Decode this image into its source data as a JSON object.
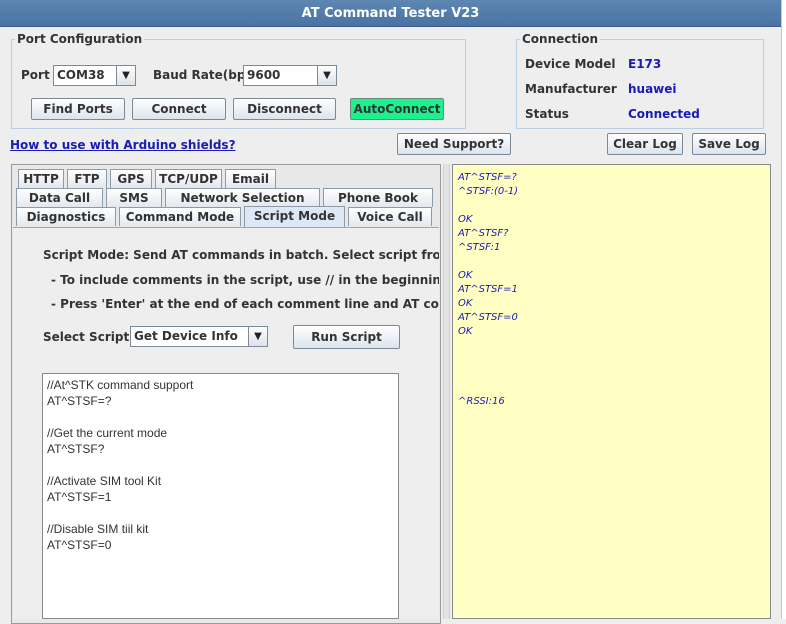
{
  "window": {
    "title": "AT Command Tester V23"
  },
  "port_config": {
    "legend": "Port Configuration",
    "port_label": "Port",
    "port_value": "COM38",
    "baud_label": "Baud Rate(bps)",
    "baud_value": "9600",
    "buttons": {
      "find_ports": "Find Ports",
      "connect": "Connect",
      "disconnect": "Disconnect",
      "autoconnect": "AutoConnect"
    }
  },
  "connection": {
    "legend": "Connection",
    "device_model_label": "Device Model",
    "device_model_value": "E173",
    "manufacturer_label": "Manufacturer",
    "manufacturer_value": "huawei",
    "status_label": "Status",
    "status_value": "Connected"
  },
  "toolbar": {
    "arduino_link": "How to use with Arduino shields?",
    "need_support": "Need Support?",
    "clear_log": "Clear Log",
    "save_log": "Save Log"
  },
  "tabs": {
    "row1": [
      "HTTP",
      "FTP",
      "GPS",
      "TCP/UDP",
      "Email"
    ],
    "row2": [
      "Data Call",
      "SMS",
      "Network Selection",
      "Phone Book"
    ],
    "row3": [
      "Diagnostics",
      "Command Mode",
      "Script Mode",
      "Voice Call"
    ],
    "active": "Script Mode"
  },
  "script_mode": {
    "description": "Script Mode: Send AT commands in batch. Select script from the drop",
    "note1": "- To include comments in the script, use // in the beginning of the line",
    "note2": "- Press 'Enter' at the end of each comment line and AT command line",
    "select_label": "Select Script",
    "select_value": "Get Device Info",
    "run_button": "Run Script",
    "script_lines": [
      "//At^STK command support",
      "AT^STSF=?",
      "",
      "//Get the current  mode",
      "AT^STSF?",
      "",
      "//Activate SIM tool Kit",
      "AT^STSF=1",
      "",
      "//Disable SIM tiil kit",
      "AT^STSF=0"
    ]
  },
  "log": {
    "lines": [
      "AT^STSF=?",
      "^STSF:(0-1)",
      "",
      "OK",
      "AT^STSF?",
      "^STSF:1",
      "",
      "OK",
      "AT^STSF=1",
      "OK",
      "AT^STSF=0",
      "OK",
      "",
      "",
      "",
      "",
      "",
      "^RSSI:16"
    ]
  },
  "colors": {
    "title_bar": "#4a73a3",
    "link": "#1a1ab5",
    "autoconnect": "#1ef08f",
    "log_background": "#ffffc4"
  }
}
